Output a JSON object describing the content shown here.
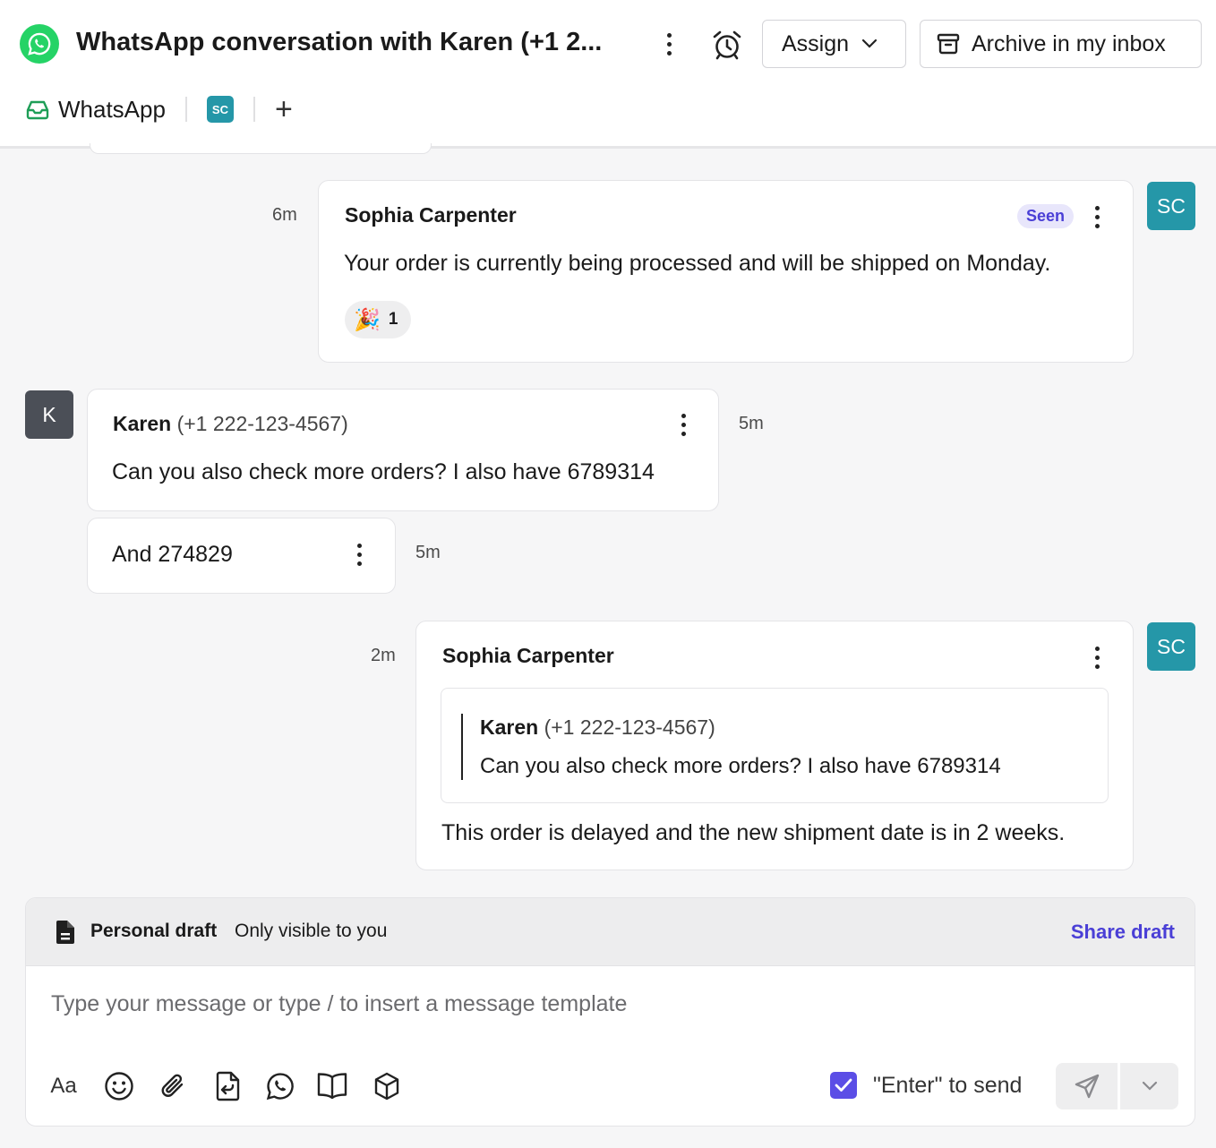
{
  "header": {
    "title": "WhatsApp conversation with Karen (+1 2...",
    "assign_label": "Assign",
    "archive_label": "Archive in my inbox"
  },
  "tabs": {
    "channel_label": "WhatsApp",
    "agent_initials": "SC",
    "add_label": "+"
  },
  "messages": [
    {
      "sender": "Sophia Carpenter",
      "time": "6m",
      "status": "Seen",
      "text": "Your order is currently being processed and will be shipped on Monday.",
      "reaction_emoji": "🎉",
      "reaction_count": "1",
      "avatar": "SC"
    },
    {
      "sender": "Karen",
      "phone": "(+1 222-123-4567)",
      "time": "5m",
      "text": "Can you also check more orders? I also have 6789314",
      "avatar": "K"
    },
    {
      "text": "And 274829",
      "time": "5m"
    },
    {
      "sender": "Sophia Carpenter",
      "time": "2m",
      "avatar": "SC",
      "quote_sender": "Karen",
      "quote_phone": "(+1 222-123-4567)",
      "quote_text": "Can you also check more orders? I also have 6789314",
      "text": "This order is delayed and the new shipment date is in 2 weeks."
    }
  ],
  "composer": {
    "draft_title": "Personal draft",
    "draft_subtitle": "Only visible to you",
    "share_label": "Share draft",
    "placeholder": "Type your message or type / to insert a message template",
    "format_label": "Aa",
    "enter_to_send_label": "\"Enter\" to send",
    "enter_to_send_checked": true
  },
  "colors": {
    "whatsapp_green": "#25d366",
    "agent_teal": "#2597a8",
    "accent_purple": "#4a3fd6",
    "customer_gray": "#4b4f57"
  }
}
